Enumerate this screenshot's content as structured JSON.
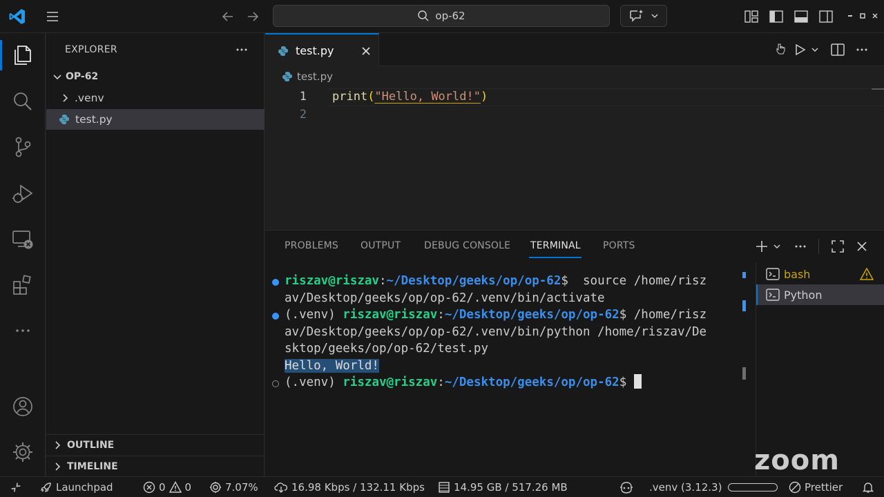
{
  "titlebar": {
    "search_text": "op-62"
  },
  "sidebar": {
    "header": "EXPLORER",
    "folder": "OP-62",
    "items": [
      {
        "label": ".venv",
        "kind": "folder"
      },
      {
        "label": "test.py",
        "kind": "file"
      }
    ],
    "outline": "OUTLINE",
    "timeline": "TIMELINE"
  },
  "editor": {
    "tab_label": "test.py",
    "breadcrumb": "test.py",
    "lines": [
      {
        "number": "1",
        "fn": "print",
        "open": "(",
        "str": "\"Hello, World!\"",
        "close": ")"
      },
      {
        "number": "2"
      }
    ]
  },
  "panel": {
    "tabs": [
      "PROBLEMS",
      "OUTPUT",
      "DEBUG CONSOLE",
      "TERMINAL",
      "PORTS"
    ],
    "active_tab": "TERMINAL",
    "terminal": {
      "l1_user": "riszav@riszav",
      "l1_colon": ":",
      "l1_path": "~/Desktop/geeks/op/op-62",
      "l1_cmd": "$  source /home/risz",
      "l2": "av/Desktop/geeks/op/op-62/.venv/bin/activate",
      "l3_env": "(.venv) ",
      "l3_user": "riszav@riszav",
      "l3_colon": ":",
      "l3_path": "~/Desktop/geeks/op/op-62",
      "l3_cmd": "$ /home/risz",
      "l4": "av/Desktop/geeks/op/op-62/.venv/bin/python /home/riszav/De",
      "l5": "sktop/geeks/op/op-62/test.py",
      "l6": "Hello, World!",
      "l7_env": "(.venv) ",
      "l7_user": "riszav@riszav",
      "l7_colon": ":",
      "l7_path": "~/Desktop/geeks/op/op-62",
      "l7_cmd": "$ "
    },
    "terminals": [
      {
        "label": "bash",
        "warning": true
      },
      {
        "label": "Python",
        "warning": false
      }
    ]
  },
  "statusbar": {
    "launchpad": "Launchpad",
    "errors": "0",
    "warnings": "0",
    "cpu": "7.07%",
    "network": "16.98 Kbps / 132.11 Kbps",
    "memory": "14.95 GB / 517.26 MB",
    "python_env": ".venv (3.12.3)",
    "prettier": "Prettier"
  },
  "watermark": "zoom",
  "colors": {
    "accent": "#0078d4",
    "terminal_user": "#23d18b",
    "terminal_path": "#3b8eea",
    "string": "#ce9178",
    "function": "#dcdcaa",
    "warning": "#cca700"
  }
}
